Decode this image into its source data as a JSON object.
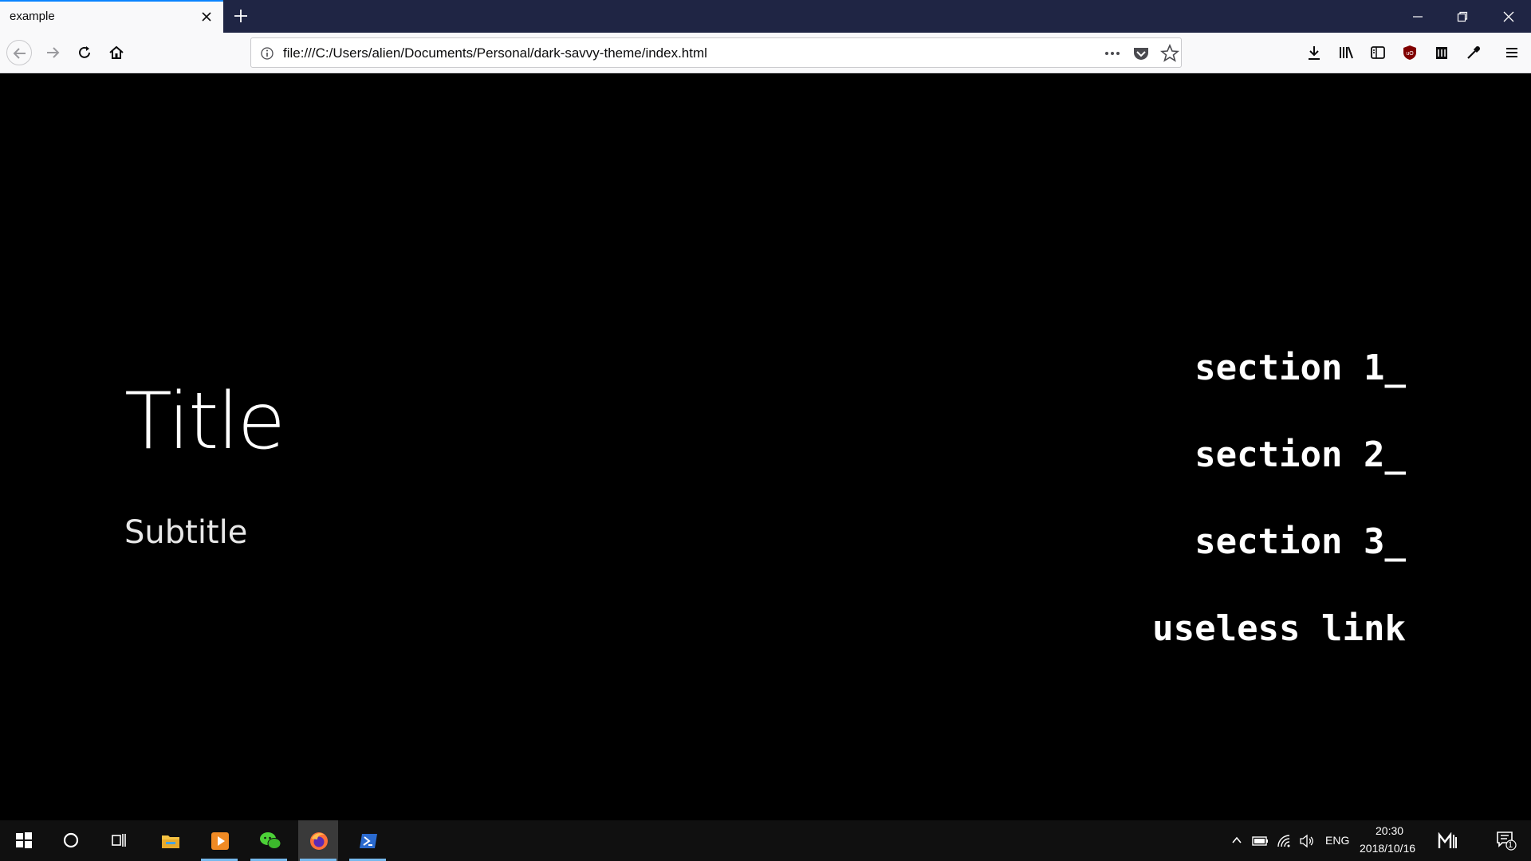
{
  "browser": {
    "tab_title": "example",
    "url": "file:///C:/Users/alien/Documents/Personal/dark-savvy-theme/index.html"
  },
  "page": {
    "title": "Title",
    "subtitle": "Subtitle",
    "links": [
      "section 1_",
      "section 2_",
      "section 3_",
      "useless link"
    ]
  },
  "taskbar": {
    "language": "ENG",
    "time": "20:30",
    "date": "2018/10/16",
    "notification_count": "1"
  },
  "colors": {
    "page_background": "#000000",
    "titlebar": "#1f2544",
    "accent": "#0a84ff"
  }
}
